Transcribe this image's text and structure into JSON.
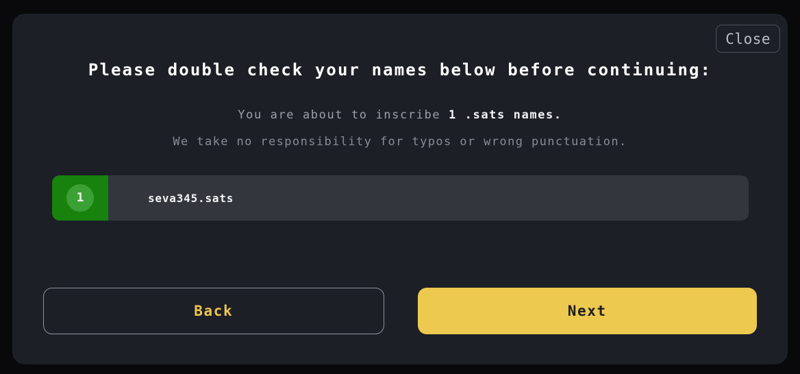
{
  "modal": {
    "close_label": "Close",
    "title": "Please double check your names below before continuing:",
    "subtitle_lead": "You are about to inscribe ",
    "subtitle_emphasis": "1 .sats names.",
    "subtitle_secondary": "We take no responsibility for typos or wrong punctuation.",
    "names": [
      {
        "index": "1",
        "name": "seva345.sats"
      }
    ],
    "back_label": "Back",
    "next_label": "Next"
  },
  "colors": {
    "page_background": "#09090b",
    "modal_background": "#1c1f26",
    "row_background": "#33363d",
    "index_block_green": "#17820d",
    "index_circle_green": "#3ba134",
    "accent_gold": "#edc94f",
    "secondary_text": "#868c96",
    "border_gray": "#4a4f59"
  }
}
